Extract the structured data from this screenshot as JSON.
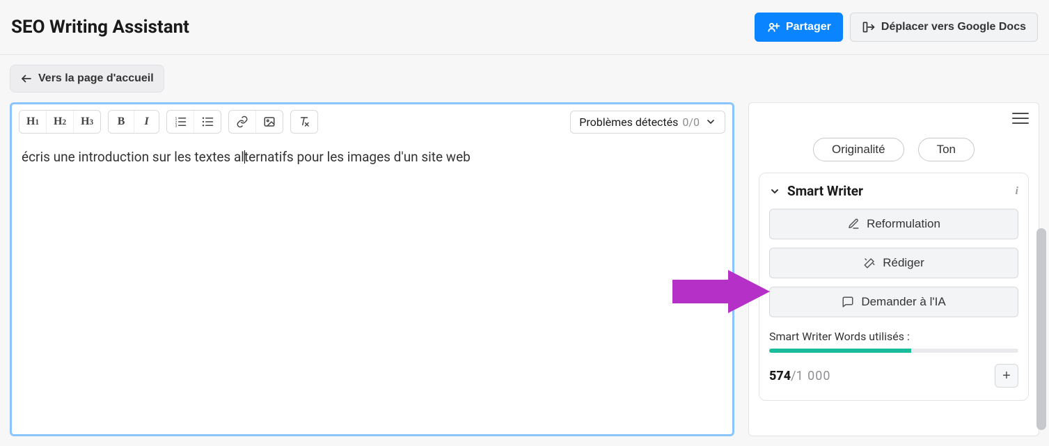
{
  "header": {
    "title": "SEO Writing Assistant",
    "share_label": "Partager",
    "move_label": "Déplacer vers Google Docs"
  },
  "subnav": {
    "home_label": "Vers la page d'accueil"
  },
  "toolbar": {
    "h1": "H",
    "h2": "H",
    "h3": "H",
    "bold": "B",
    "italic": "I"
  },
  "issues": {
    "label": "Problèmes détectés",
    "count": "0/0"
  },
  "editor": {
    "content_before_cursor": "écris une introduction sur les textes al",
    "content_after_cursor": "ternatifs pour les images d'un site web"
  },
  "sidebar": {
    "pills": {
      "originality": "Originalité",
      "tone": "Ton"
    },
    "smart_writer": {
      "title": "Smart Writer",
      "reformulate": "Reformulation",
      "write": "Rédiger",
      "ask_ai": "Demander à l'IA",
      "usage_label": "Smart Writer Words utilisés :",
      "used": "574",
      "total": "1 000",
      "progress_pct": 57
    }
  }
}
